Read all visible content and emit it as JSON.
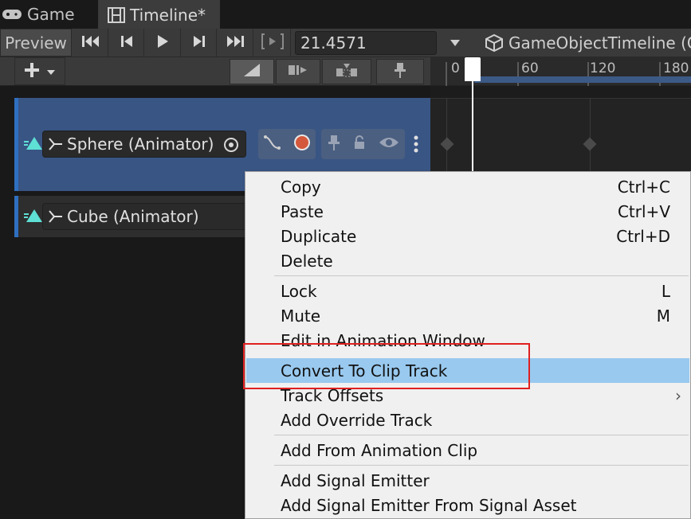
{
  "tabs": [
    {
      "label": "Game"
    },
    {
      "label": "Timeline*"
    }
  ],
  "toolbar": {
    "preview_label": "Preview",
    "time_value": "21.4571",
    "asset_label": "GameObjectTimeline (G"
  },
  "ruler": {
    "ticks": [
      "0",
      "60",
      "120",
      "180"
    ]
  },
  "tracks": [
    {
      "name": "Sphere (Animator)"
    },
    {
      "name": "Cube (Animator)"
    }
  ],
  "context_menu": {
    "items": [
      {
        "label": "Copy",
        "shortcut": "Ctrl+C"
      },
      {
        "label": "Paste",
        "shortcut": "Ctrl+V"
      },
      {
        "label": "Duplicate",
        "shortcut": "Ctrl+D"
      },
      {
        "label": "Delete",
        "shortcut": ""
      },
      {
        "label": "Lock",
        "shortcut": "L"
      },
      {
        "label": "Mute",
        "shortcut": "M"
      },
      {
        "label": "Edit in Animation Window",
        "shortcut": ""
      },
      {
        "label": "Convert To Clip Track",
        "shortcut": ""
      },
      {
        "label": "Track Offsets",
        "shortcut": "›"
      },
      {
        "label": "Add Override Track",
        "shortcut": ""
      },
      {
        "label": "Add From Animation Clip",
        "shortcut": ""
      },
      {
        "label": "Add Signal Emitter",
        "shortcut": ""
      },
      {
        "label": "Add Signal Emitter From Signal Asset",
        "shortcut": ""
      }
    ],
    "highlighted_index": 7
  },
  "colors": {
    "menu_highlight": "#99c9ef",
    "annotation_box": "#e02020",
    "track_selected": "#395584",
    "track_accent": "#2f6fc0"
  }
}
